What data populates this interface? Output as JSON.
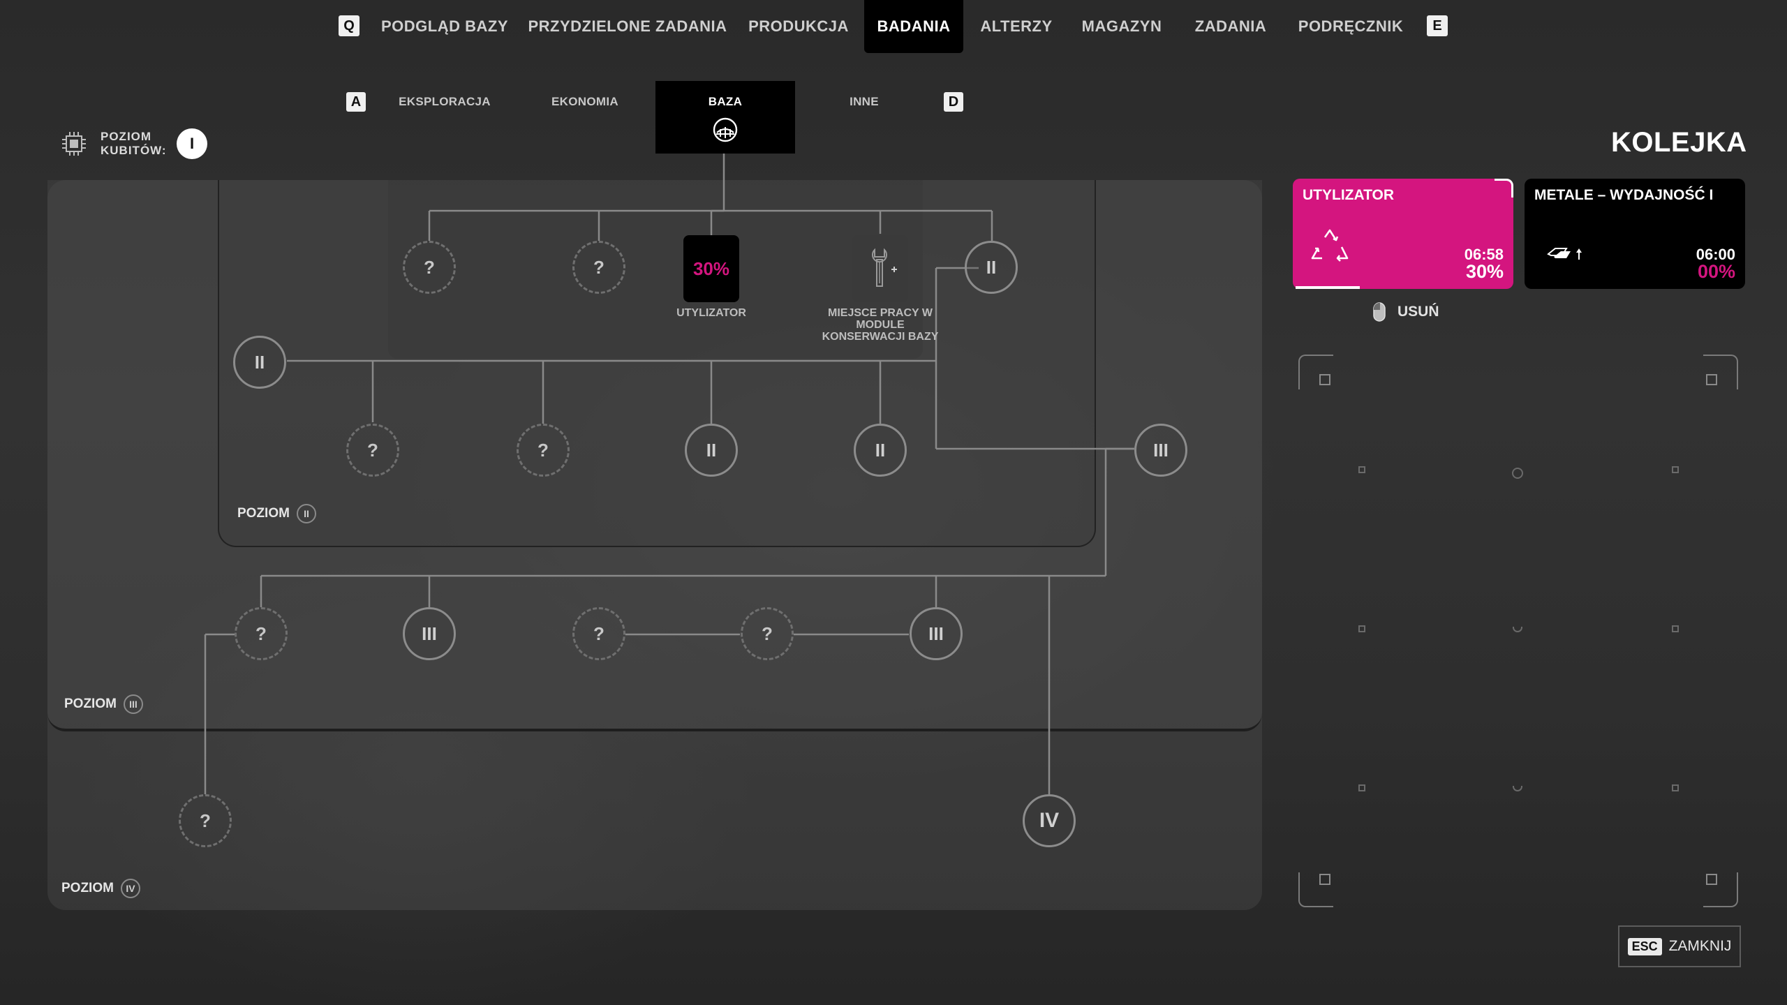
{
  "nav": {
    "key_left": "Q",
    "key_right": "E",
    "items": [
      {
        "label": "PODGLĄD BAZY"
      },
      {
        "label": "PRZYDZIELONE ZADANIA"
      },
      {
        "label": "PRODUKCJA"
      },
      {
        "label": "BADANIA"
      },
      {
        "label": "ALTERZY"
      },
      {
        "label": "MAGAZYN"
      },
      {
        "label": "ZADANIA"
      },
      {
        "label": "PODRĘCZNIK"
      }
    ]
  },
  "subnav": {
    "key_left": "A",
    "key_right": "D",
    "tabs": [
      {
        "label": "EKSPLORACJA"
      },
      {
        "label": "EKONOMIA"
      },
      {
        "label": "BAZA"
      },
      {
        "label": "INNE"
      }
    ]
  },
  "cubit": {
    "label_line1": "POZIOM",
    "label_line2": "KUBITÓW:",
    "level": "I"
  },
  "tree": {
    "levels": [
      {
        "label": "POZIOM",
        "roman": "II"
      },
      {
        "label": "POZIOM",
        "roman": "III"
      },
      {
        "label": "POZIOM",
        "roman": "IV"
      }
    ],
    "unknown_symbol": "?",
    "roman_ii": "II",
    "roman_iii": "III",
    "roman_iv": "IV",
    "utylizator": {
      "percent": "30%",
      "caption": "UTYLIZATOR"
    },
    "workplace": {
      "caption": "MIEJSCE PRACY W MODULE KONSERWACJI BAZY"
    }
  },
  "queue": {
    "title": "KOLEJKA",
    "items": [
      {
        "name": "UTYLIZATOR",
        "time": "06:58",
        "percent": "30%",
        "progress": 0.3
      },
      {
        "name": "METALE – WYDAJNOŚĆ I",
        "time": "06:00",
        "percent": "00%",
        "progress": 0
      }
    ],
    "remove_label": "USUŃ"
  },
  "close": {
    "key": "ESC",
    "label": "ZAMKNIJ"
  },
  "colors": {
    "accent": "#d4157f",
    "active_tab": "#000000",
    "line": "#8a8a8a"
  }
}
